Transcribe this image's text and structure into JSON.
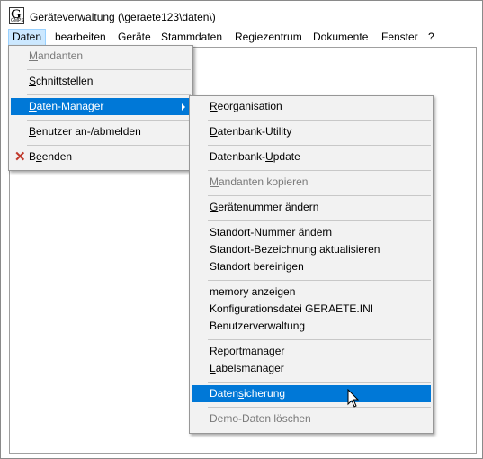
{
  "window": {
    "title": "Geräteverwaltung (\\geraete123\\daten\\)"
  },
  "app_icon": {
    "glyph": "G",
    "sub": "GMPS"
  },
  "menubar": [
    {
      "label": "Daten"
    },
    {
      "label": "bearbeiten"
    },
    {
      "label": "Geräte"
    },
    {
      "label": "Stammdaten"
    },
    {
      "label": "Regiezentrum"
    },
    {
      "label": "Dokumente"
    },
    {
      "label": "Fenster"
    },
    {
      "label": "?"
    }
  ],
  "daten_menu": [
    {
      "pre": "",
      "ul": "M",
      "post": "andanten",
      "disabled": true
    },
    {
      "pre": "",
      "ul": "S",
      "post": "chnittstellen"
    },
    {
      "pre": "",
      "ul": "D",
      "post": "aten-Manager",
      "selected": true,
      "submenu": true
    },
    {
      "pre": "",
      "ul": "B",
      "post": "enutzer an-/abmelden"
    },
    {
      "pre": "B",
      "ul": "e",
      "post": "enden",
      "icon": "close-icon"
    }
  ],
  "manager_menu": [
    {
      "pre": "",
      "ul": "R",
      "post": "eorganisation"
    },
    {
      "pre": "",
      "ul": "D",
      "post": "atenbank-Utility"
    },
    {
      "pre": "Datenbank-",
      "ul": "U",
      "post": "pdate"
    },
    {
      "pre": "",
      "ul": "M",
      "post": "andanten kopieren",
      "disabled": true
    },
    {
      "pre": "",
      "ul": "G",
      "post": "erätenummer ändern"
    },
    {
      "pre": "",
      "ul": "",
      "post": "Standort-Nummer ändern"
    },
    {
      "pre": "",
      "ul": "",
      "post": "Standort-Bezeichnung aktualisieren"
    },
    {
      "pre": "",
      "ul": "",
      "post": "Standort bereinigen"
    },
    {
      "pre": "",
      "ul": "",
      "post": "memory anzeigen"
    },
    {
      "pre": "",
      "ul": "",
      "post": "Konfigurationsdatei GERAETE.INI"
    },
    {
      "pre": "",
      "ul": "",
      "post": "Benutzerverwaltung"
    },
    {
      "pre": "Re",
      "ul": "p",
      "post": "ortmanager"
    },
    {
      "pre": "",
      "ul": "L",
      "post": "abelsmanager"
    },
    {
      "pre": "Daten",
      "ul": "s",
      "post": "icherung",
      "selected": true
    },
    {
      "pre": "",
      "ul": "",
      "post": "Demo-Daten löschen",
      "disabled": true
    }
  ]
}
